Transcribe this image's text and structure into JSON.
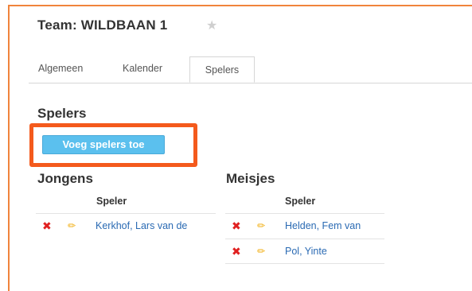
{
  "header": {
    "title": "Team: WILDBAAN 1",
    "favorite_icon": "star-icon"
  },
  "tabs": [
    {
      "label": "Algemeen",
      "active": false
    },
    {
      "label": "Kalender",
      "active": false
    },
    {
      "label": "Spelers",
      "active": true
    }
  ],
  "section": {
    "title": "Spelers",
    "add_button_label": "Voeg spelers toe"
  },
  "groups": [
    {
      "title": "Jongens",
      "column_header": "Speler",
      "rows": [
        {
          "name": "Kerkhof, Lars van de"
        }
      ]
    },
    {
      "title": "Meisjes",
      "column_header": "Speler",
      "rows": [
        {
          "name": "Helden, Fem van"
        },
        {
          "name": "Pol, Yinte"
        }
      ]
    }
  ],
  "row_icons": {
    "delete": "close-icon",
    "edit": "pencil-icon"
  },
  "colors": {
    "highlight": "#f45a1c",
    "button": "#5bc0ee",
    "delete_icon": "#e02020",
    "edit_icon": "#f0a800",
    "link": "#2a6ab3"
  }
}
